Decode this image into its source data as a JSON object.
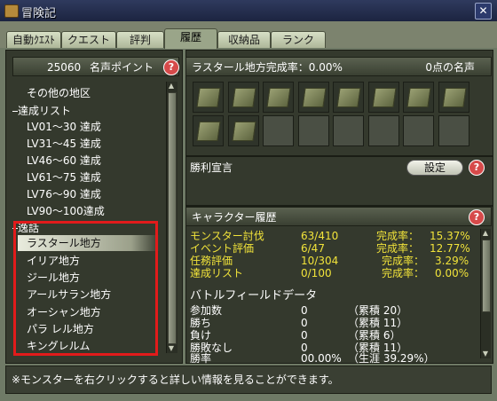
{
  "window": {
    "title": "冒険記"
  },
  "tabs": [
    {
      "label": "自動ｸｴｽﾄ"
    },
    {
      "label": "クエスト"
    },
    {
      "label": "評判"
    },
    {
      "label": "履歴"
    },
    {
      "label": "収納品"
    },
    {
      "label": "ランク"
    }
  ],
  "left": {
    "points_value": "25060",
    "points_label": "名声ポイント",
    "items_top": [
      "その他の地区"
    ],
    "section1": "達成リスト",
    "achievements": [
      "LV01～30 達成",
      "LV31～45 達成",
      "LV46～60 達成",
      "LV61～75 達成",
      "LV76～90 達成",
      "LV90～100達成"
    ],
    "section2": "逸話",
    "regions": [
      "ラスタール地方",
      "イリア地方",
      "ジール地方",
      "アールサラン地方",
      "オーシャン地方",
      "パラ レル地方",
      "キングレルム"
    ]
  },
  "titles": {
    "header": "ラスタール地方完成率：0.00%",
    "header_right": "0点の名声",
    "filled_slots": 10,
    "total_slots": 24
  },
  "victory": {
    "header": "勝利宣言",
    "settings_label": "設定"
  },
  "history": {
    "header": "キャラクター履歴",
    "stats": [
      {
        "label": "モンスター討伐",
        "value": "63/410",
        "rate_label": "完成率：",
        "rate": "15.37%"
      },
      {
        "label": "イベント評価",
        "value": "6/47",
        "rate_label": "完成率：",
        "rate": "12.77%"
      },
      {
        "label": "任務評価",
        "value": "10/304",
        "rate_label": "完成率：",
        "rate": "3.29%"
      },
      {
        "label": "達成リスト",
        "value": "0/100",
        "rate_label": "完成率：",
        "rate": "0.00%"
      }
    ],
    "bf_header": "バトルフィールドデータ",
    "bf": [
      {
        "label": "参加数",
        "value": "0",
        "cum": "（累積 20）"
      },
      {
        "label": "勝ち",
        "value": "0",
        "cum": "（累積 11）"
      },
      {
        "label": "負け",
        "value": "0",
        "cum": "（累積 6）"
      },
      {
        "label": "勝敗なし",
        "value": "0",
        "cum": "（累積 11）"
      },
      {
        "label": "勝率",
        "value": "00.00%",
        "cum": "（生涯 39.29%）"
      }
    ]
  },
  "footer": {
    "text": "※モンスターを右クリックすると詳しい情報を見ることができます。"
  },
  "colors": {
    "highlight": "#e21b1b",
    "stat_yellow": "#f1e33a"
  },
  "icons": {
    "help": "question-mark",
    "close": "close-icon",
    "window": "book-icon"
  }
}
